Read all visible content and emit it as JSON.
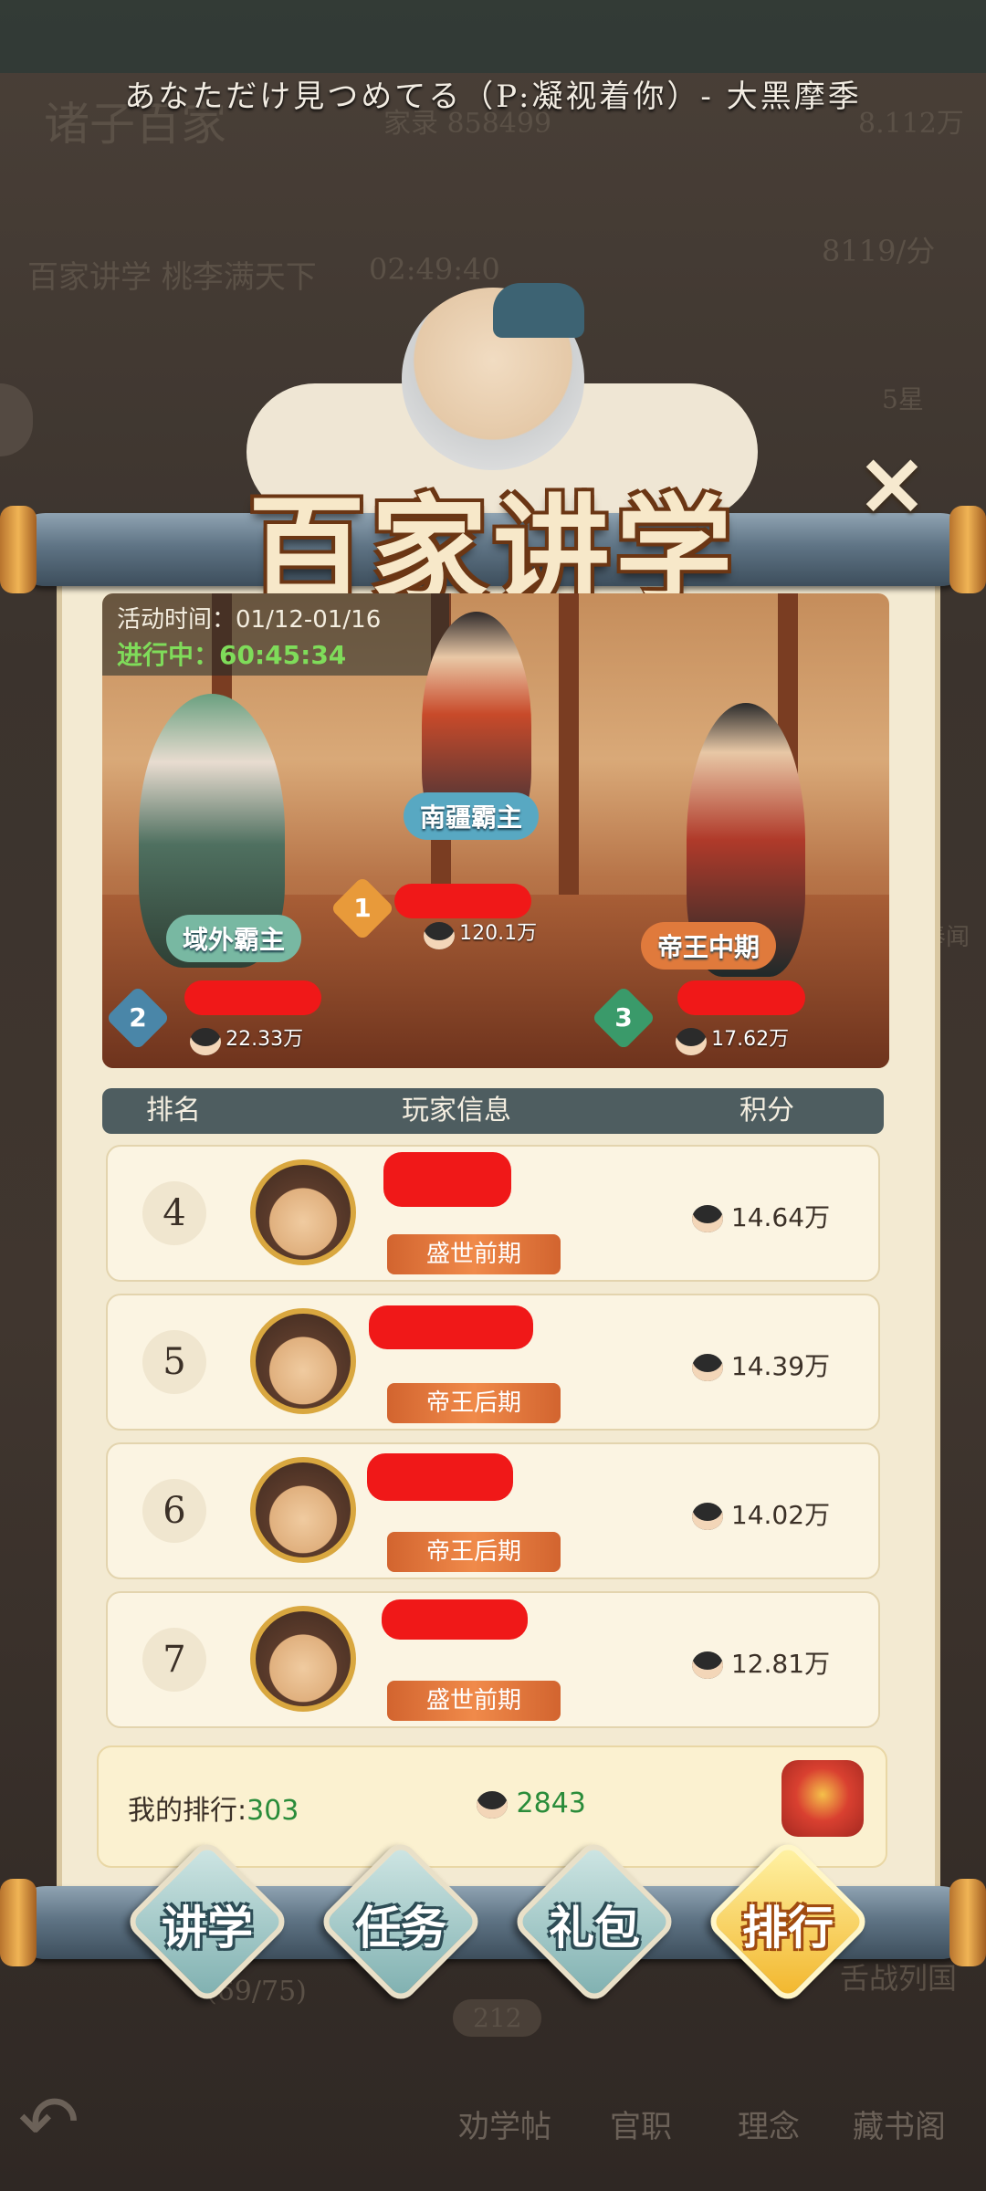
{
  "song_title": "あなただけ見つめてる（P:凝视着你）- 大黑摩季",
  "background": {
    "game_title": "诸子百家",
    "resource": "家录 858499",
    "currency": "8.112万",
    "rate": "8119/分",
    "event_banner": "百家讲学 桃李满天下",
    "event_timer": "02:49:40",
    "side_badge": "5星",
    "right_label": "奉闻",
    "war_label": "舌战列国",
    "progress": "(69/75)",
    "level_badge": "212",
    "nav": [
      "劝学帖",
      "官职",
      "理念",
      "藏书阁"
    ]
  },
  "panel": {
    "title": "百家讲学",
    "close_icon": "×"
  },
  "activity": {
    "time_label": "活动时间：01/12-01/16",
    "status_label": "进行中：60:45:34"
  },
  "podium": {
    "first": {
      "rank": "1",
      "title": "南疆霸主",
      "score": "120.1万"
    },
    "second": {
      "rank": "2",
      "title": "域外霸主",
      "score": "22.33万"
    },
    "third": {
      "rank": "3",
      "title": "帝王中期",
      "score": "17.62万"
    }
  },
  "table": {
    "headers": {
      "rank": "排名",
      "player": "玩家信息",
      "score": "积分"
    },
    "rows": [
      {
        "rank": "4",
        "stage": "盛世前期",
        "score": "14.64万"
      },
      {
        "rank": "5",
        "stage": "帝王后期",
        "score": "14.39万"
      },
      {
        "rank": "6",
        "stage": "帝王后期",
        "score": "14.02万"
      },
      {
        "rank": "7",
        "stage": "盛世前期",
        "score": "12.81万"
      }
    ]
  },
  "my_rank": {
    "label": "我的排行:",
    "rank": "303",
    "score": "2843"
  },
  "tabs": [
    {
      "label": "讲学",
      "active": false
    },
    {
      "label": "任务",
      "active": false
    },
    {
      "label": "礼包",
      "active": false
    },
    {
      "label": "排行",
      "active": true
    }
  ],
  "colors": {
    "accent_green": "#2a8c3a",
    "status_green": "#7fdc5a",
    "scroll_paper": "#f3ead2",
    "active_tab": "#f2b62c"
  }
}
